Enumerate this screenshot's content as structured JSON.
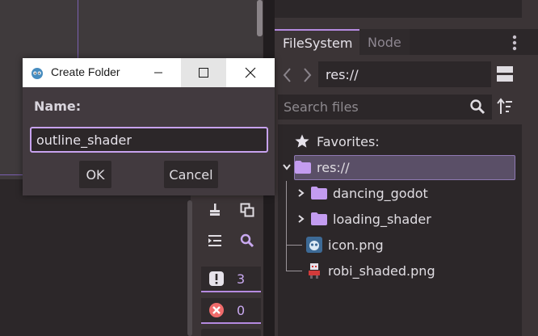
{
  "dialog": {
    "title": "Create Folder",
    "name_label": "Name:",
    "name_value": "outline_shader",
    "ok_label": "OK",
    "cancel_label": "Cancel"
  },
  "dock": {
    "tabs": [
      {
        "label": "FileSystem",
        "active": true
      },
      {
        "label": "Node",
        "active": false
      }
    ],
    "path": "res://",
    "search_placeholder": "Search files",
    "tree": {
      "favorites_label": "Favorites:",
      "root_label": "res://",
      "items": [
        {
          "label": "dancing_godot",
          "kind": "folder"
        },
        {
          "label": "loading_shader",
          "kind": "folder"
        },
        {
          "label": "icon.png",
          "kind": "image"
        },
        {
          "label": "robi_shaded.png",
          "kind": "image"
        }
      ]
    }
  },
  "bottom": {
    "warnings_count": "3",
    "errors_count": "0"
  },
  "colors": {
    "accent": "#b58ae0",
    "folder": "#c39cf0",
    "panel_bg": "#3b3436",
    "field_bg": "#2c2729"
  }
}
